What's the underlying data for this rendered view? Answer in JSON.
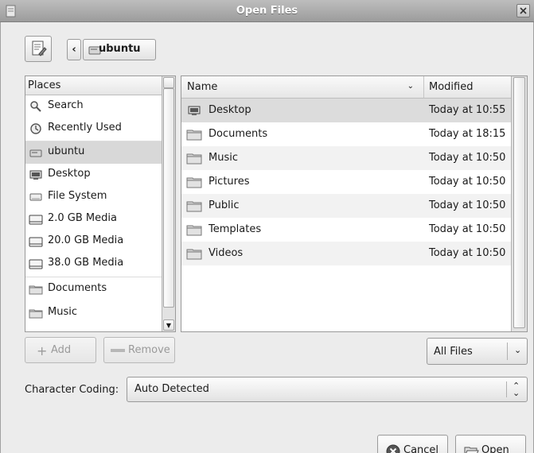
{
  "window": {
    "title": "Open Files"
  },
  "location": {
    "back_symbol": "‹",
    "current": "ubuntu"
  },
  "places": {
    "header": "Places",
    "items": [
      {
        "label": "Search",
        "icon": "search-icon"
      },
      {
        "label": "Recently Used",
        "icon": "recent-icon"
      },
      {
        "label": "ubuntu",
        "icon": "home-drive-icon",
        "selected": true
      },
      {
        "label": "Desktop",
        "icon": "desktop-icon"
      },
      {
        "label": "File System",
        "icon": "filesystem-icon"
      },
      {
        "label": "2.0 GB Media",
        "icon": "drive-icon"
      },
      {
        "label": "20.0 GB Media",
        "icon": "drive-icon"
      },
      {
        "label": "38.0 GB Media",
        "icon": "drive-icon"
      },
      {
        "label": "Documents",
        "icon": "folder-icon"
      },
      {
        "label": "Music",
        "icon": "folder-icon"
      }
    ],
    "add_label": "Add",
    "remove_label": "Remove"
  },
  "files": {
    "col_name": "Name",
    "col_modified": "Modified",
    "sort_indicator": "⌄",
    "rows": [
      {
        "name": "Desktop",
        "modified": "Today at 10:55",
        "icon": "desktop-icon",
        "selected": true
      },
      {
        "name": "Documents",
        "modified": "Today at 18:15",
        "icon": "folder-icon"
      },
      {
        "name": "Music",
        "modified": "Today at 10:50",
        "icon": "folder-icon"
      },
      {
        "name": "Pictures",
        "modified": "Today at 10:50",
        "icon": "folder-icon"
      },
      {
        "name": "Public",
        "modified": "Today at 10:50",
        "icon": "folder-icon"
      },
      {
        "name": "Templates",
        "modified": "Today at 10:50",
        "icon": "folder-icon"
      },
      {
        "name": "Videos",
        "modified": "Today at 10:50",
        "icon": "folder-icon"
      }
    ]
  },
  "filter": {
    "selected": "All Files"
  },
  "encoding": {
    "label": "Character Coding:",
    "selected": "Auto Detected"
  },
  "actions": {
    "cancel_label": "Cancel",
    "open_label": "Open"
  }
}
